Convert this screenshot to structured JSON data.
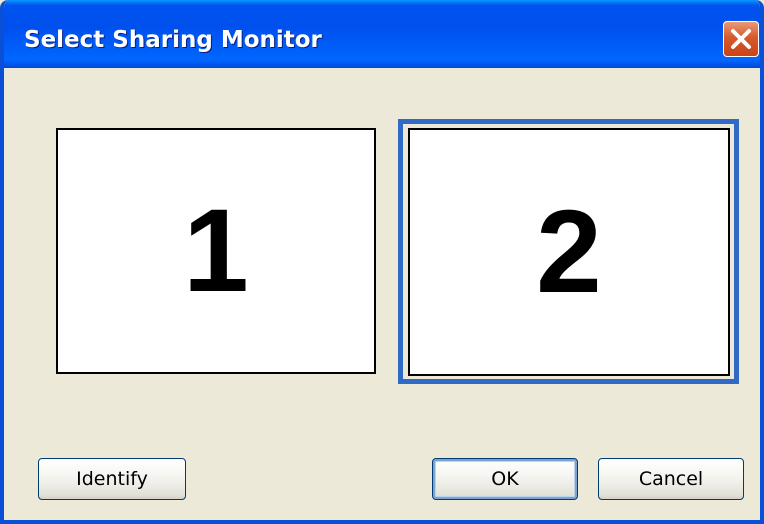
{
  "window": {
    "title": "Select Sharing Monitor",
    "close_icon": "close-icon"
  },
  "monitors": [
    {
      "label": "1",
      "selected": false
    },
    {
      "label": "2",
      "selected": true
    }
  ],
  "buttons": {
    "identify": "Identify",
    "ok": "OK",
    "cancel": "Cancel"
  },
  "colors": {
    "titlebar": "#0050ee",
    "selection_border": "#316ac5",
    "close_button": "#d65a2c",
    "dialog_background": "#ece9d8"
  }
}
